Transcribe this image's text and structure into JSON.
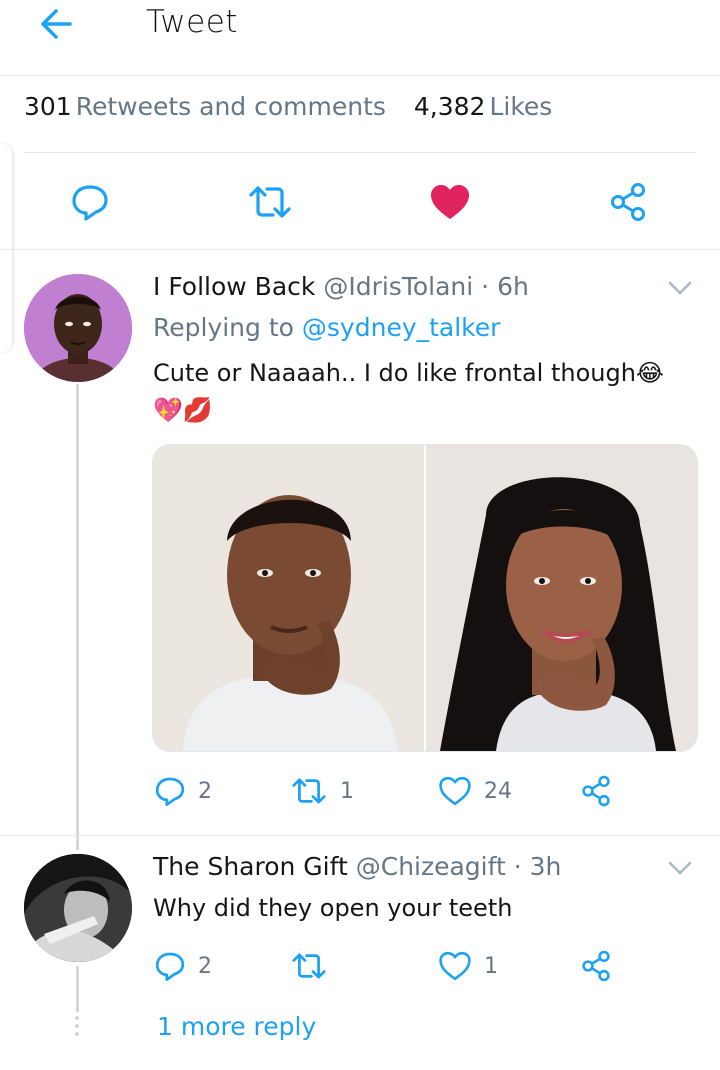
{
  "header": {
    "title": "Tweet",
    "back_icon": "arrow-left-icon"
  },
  "stats": {
    "retweets_count": "301",
    "retweets_label": "Retweets and comments",
    "likes_count": "4,382",
    "likes_label": "Likes"
  },
  "actions": [
    "reply-icon",
    "retweet-icon",
    "heart-filled-icon",
    "share-icon"
  ],
  "colors": {
    "accent": "#1da1f2",
    "like": "#e0245e",
    "muted": "#657786",
    "divider": "#e1e8ed"
  },
  "replies": [
    {
      "name": "I Follow Back",
      "handle": "@IdrisTolani",
      "time": "· 6h",
      "replying_prefix": "Replying to",
      "replying_to": "@sydney_talker",
      "text": "Cute or Naaaah.. I do like frontal though😂",
      "emoji_line": "💖💋",
      "reply_count": "2",
      "retweet_count": "1",
      "like_count": "24"
    },
    {
      "name": "The Sharon Gift",
      "handle": "@Chizeagift",
      "time": "· 3h",
      "text": "Why did they open your teeth",
      "reply_count": "2",
      "retweet_count": "",
      "like_count": "1"
    }
  ],
  "more_replies": "1 more reply"
}
